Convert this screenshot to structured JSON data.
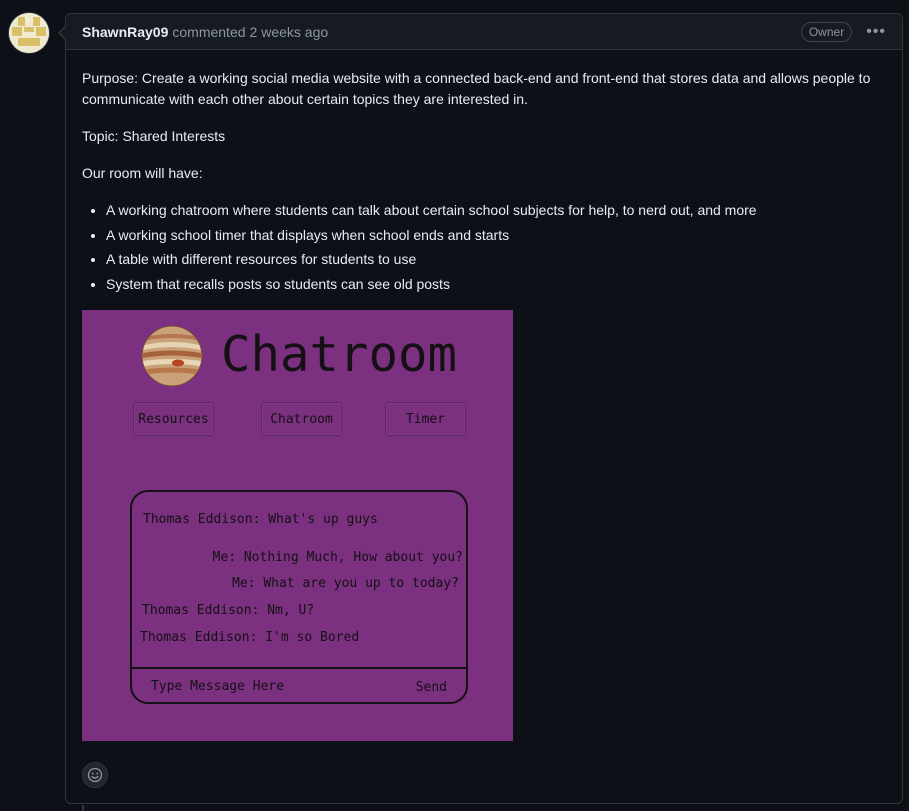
{
  "comment": {
    "author": "ShawnRay09",
    "action_text": "commented",
    "timestamp": "2 weeks ago",
    "badge": "Owner",
    "menu_icon": "kebab-horizontal-icon"
  },
  "body": {
    "purpose": "Purpose: Create a working social media website with a connected back-end and front-end that stores data and allows people to communicate with each other about certain topics they are interested in.",
    "topic": "Topic: Shared Interests",
    "room_intro": "Our room will have:",
    "features": [
      "A working chatroom where students can talk about certain school subjects for help, to nerd out, and more",
      "A working school timer that displays when school ends and starts",
      "A table with different resources for students to use",
      "System that recalls posts so students can see old posts"
    ]
  },
  "mockup": {
    "title": "Chatroom",
    "logo_icon": "planet-jupiter-icon",
    "background_color": "#7b3180",
    "nav": [
      "Resources",
      "Chatroom",
      "Timer"
    ],
    "messages": [
      "Thomas Eddison: What's up guys",
      "Me: Nothing Much, How about you?",
      "Me: What are you up to today?",
      "Thomas Eddison: Nm, U?",
      "Thomas Eddison: I'm so Bored"
    ],
    "input_placeholder": "Type Message Here",
    "send_label": "Send"
  },
  "reaction_icon": "smiley-icon",
  "colors": {
    "page_bg": "#0d1117",
    "header_bg": "#161b22",
    "border": "#30363d",
    "muted_text": "#8d96a0"
  }
}
